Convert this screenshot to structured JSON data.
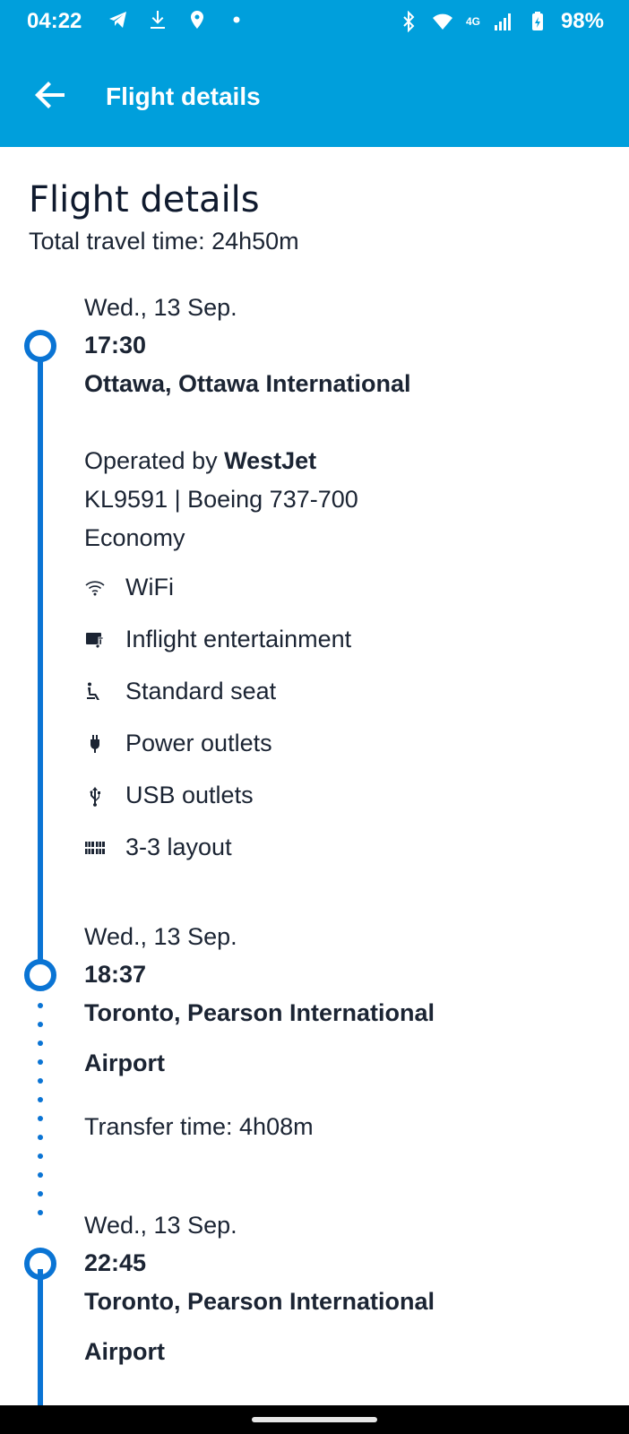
{
  "status_bar": {
    "time": "04:22",
    "network": "4G",
    "battery": "98%",
    "icons": [
      "telegram-icon",
      "download-icon",
      "location-icon",
      "dot-icon",
      "bluetooth-icon",
      "wifi-icon",
      "signal-icon",
      "battery-icon"
    ]
  },
  "app_bar": {
    "title": "Flight details",
    "back_icon": "arrow-left-icon"
  },
  "page": {
    "title": "Flight details",
    "total_travel_time": "Total travel time: 24h50m"
  },
  "segments": [
    {
      "date": "Wed., 13 Sep.",
      "time": "17:30",
      "location": "Ottawa, Ottawa International",
      "operated_by_prefix": "Operated by ",
      "operator": "WestJet",
      "flight_info": "KL9591 | Boeing 737-700",
      "cabin": "Economy",
      "amenities": [
        {
          "icon": "wifi-icon",
          "label": "WiFi"
        },
        {
          "icon": "entertainment-icon",
          "label": "Inflight entertainment"
        },
        {
          "icon": "seat-icon",
          "label": "Standard seat"
        },
        {
          "icon": "power-plug-icon",
          "label": "Power outlets"
        },
        {
          "icon": "usb-icon",
          "label": "USB outlets"
        },
        {
          "icon": "seat-layout-icon",
          "label": "3-3 layout"
        }
      ]
    },
    {
      "date": "Wed., 13 Sep.",
      "time": "18:37",
      "location_line1": "Toronto, Pearson International",
      "location_line2": "Airport"
    },
    {
      "transfer": "Transfer time: 4h08m"
    },
    {
      "date": "Wed., 13 Sep.",
      "time": "22:45",
      "location_line1": "Toronto, Pearson International",
      "location_line2": "Airport"
    }
  ],
  "colors": {
    "brand": "#009fdc",
    "timeline": "#0a74d4",
    "text": "#1b2433"
  }
}
